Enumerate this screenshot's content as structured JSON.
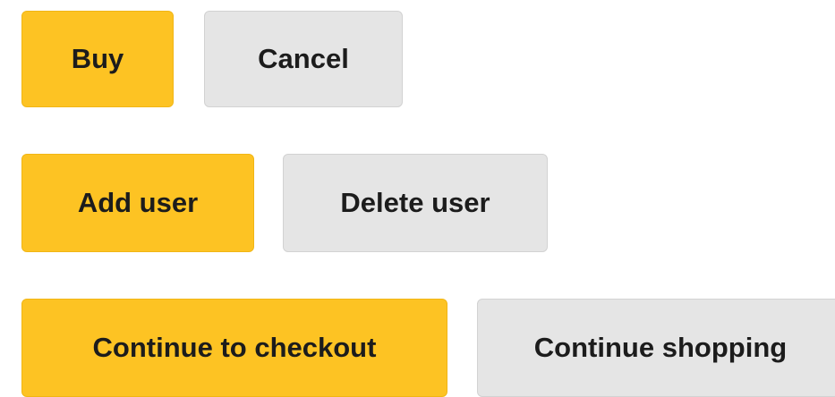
{
  "buttons": {
    "row1": {
      "primary_label": "Buy",
      "secondary_label": "Cancel"
    },
    "row2": {
      "primary_label": "Add user",
      "secondary_label": "Delete user"
    },
    "row3": {
      "primary_label": "Continue to checkout",
      "secondary_label": "Continue shopping"
    }
  },
  "colors": {
    "primary_background": "#fdc323",
    "secondary_background": "#e5e5e5",
    "text": "#1c1c1c"
  }
}
